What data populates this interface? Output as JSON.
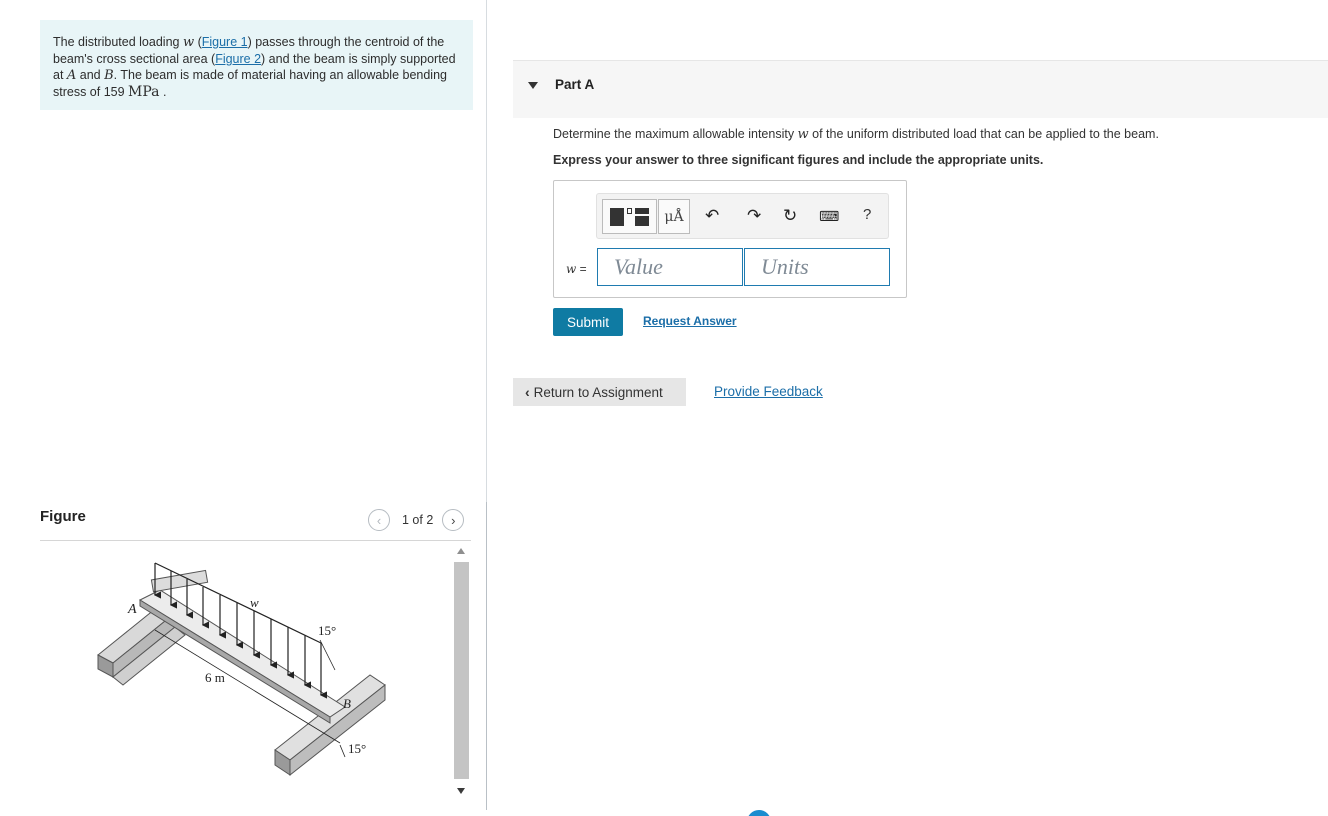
{
  "problem": {
    "t1": "The distributed loading ",
    "var_w": "w",
    "t2": " (",
    "fig1_link": "Figure 1",
    "t3": ") passes through the centroid of the beam's cross sectional area (",
    "fig2_link": "Figure 2",
    "t4": ") and the beam is simply supported at ",
    "var_A": "A",
    "t5": " and ",
    "var_B": "B",
    "t6": ". The beam is made of material having an allowable bending stress of 159 ",
    "unit": "MPa",
    "t7": " ."
  },
  "figure_panel": {
    "title": "Figure",
    "pager_count": "1 of 2",
    "prev_icon": "chevron-left-icon",
    "next_icon": "chevron-right-icon",
    "diagram_labels": {
      "A": "A",
      "w": "w",
      "angle_top": "15°",
      "span": "6 m",
      "B": "B",
      "angle_bottom": "15°"
    }
  },
  "part": {
    "title": "Part A",
    "question_pre": "Determine the maximum allowable intensity ",
    "question_var": "w",
    "question_post": " of the uniform distributed load that can be applied to the beam.",
    "instruction": "Express your answer to three significant figures and include the appropriate units."
  },
  "answer": {
    "var_label": "w",
    "equals": " =",
    "value_placeholder": "Value",
    "units_placeholder": "Units",
    "toolbar": {
      "units_button": "μÅ",
      "help": "?"
    }
  },
  "actions": {
    "submit": "Submit",
    "request_answer": "Request Answer",
    "return_label": "Return to Assignment",
    "feedback": "Provide Feedback"
  },
  "colors": {
    "problem_bg": "#e8f5f7",
    "link": "#1b6ea8",
    "submit_bg": "#0f7ba3",
    "input_border": "#1f7bb0"
  }
}
